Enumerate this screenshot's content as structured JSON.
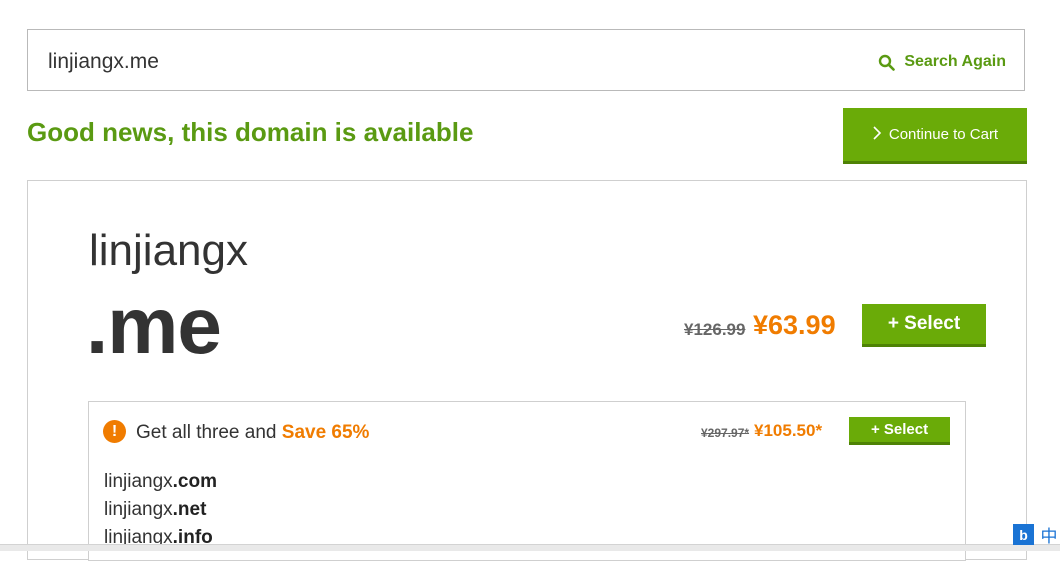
{
  "search": {
    "value": "linjiangx.me",
    "again_label": "Search Again"
  },
  "headline": "Good news, this domain is available",
  "cart": {
    "label": "Continue to Cart"
  },
  "result": {
    "sld": "linjiangx",
    "tld": ".me",
    "old_price": "¥126.99",
    "new_price": "¥63.99",
    "select_label": "+ Select"
  },
  "bundle": {
    "text_prefix": "Get all three and ",
    "save_text": "Save 65%",
    "old_price": "¥297.97*",
    "new_price": "¥105.50*",
    "select_label": "+ Select",
    "domains": [
      {
        "sld": "linjiangx",
        "tld": ".com"
      },
      {
        "sld": "linjiangx",
        "tld": ".net"
      },
      {
        "sld": "linjiangx",
        "tld": ".info"
      }
    ]
  },
  "tray": {
    "icon_glyph": "b",
    "ime_glyph": "中"
  },
  "colors": {
    "brand_green": "#6aab08",
    "headline_green": "#5a9a12",
    "price_orange": "#f07c00"
  },
  "icons": [
    "search-icon",
    "chevron-right-icon",
    "exclamation-icon",
    "bing-tray-icon",
    "ime-chinese-icon"
  ]
}
